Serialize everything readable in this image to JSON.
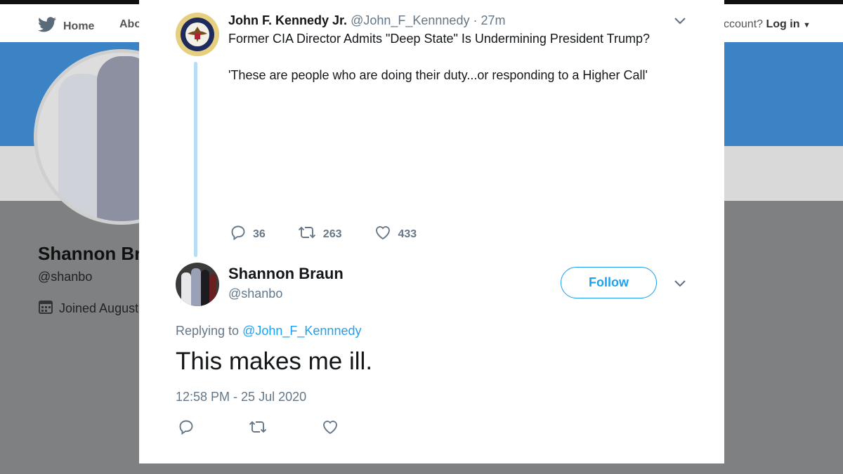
{
  "background": {
    "nav": {
      "home_label": "Home",
      "about_label": "Abo",
      "login_prefix": "ccount?",
      "login_label": "Log in"
    },
    "profile": {
      "name": "Shannon Bra",
      "handle": "@shanbo",
      "joined": "Joined August"
    }
  },
  "parent_tweet": {
    "author_name": "John F. Kennedy Jr.",
    "author_handle": "@John_F_Kennnedy",
    "time": "· 27m",
    "text_line1": "Former CIA Director Admits \"Deep State\" Is Undermining President Trump?",
    "text_line2": "'These are people who are doing their duty...or responding to a Higher Call'",
    "reply_count": "36",
    "retweet_count": "263",
    "like_count": "433"
  },
  "reply_tweet": {
    "author_name": "Shannon Braun",
    "author_handle": "@shanbo",
    "follow_label": "Follow",
    "replying_prefix": "Replying to",
    "replying_to": "@John_F_Kennnedy",
    "text": "This makes me ill.",
    "timestamp": "12:58 PM - 25 Jul 2020"
  },
  "colors": {
    "accent": "#1da1f2",
    "thread_line": "#b9dcf6",
    "muted": "#657786",
    "banner": "#3b83c4"
  },
  "icons": [
    "twitter-bird-icon",
    "calendar-icon",
    "presidential-seal-icon",
    "chevron-down-icon",
    "reply-icon",
    "retweet-icon",
    "like-icon"
  ]
}
